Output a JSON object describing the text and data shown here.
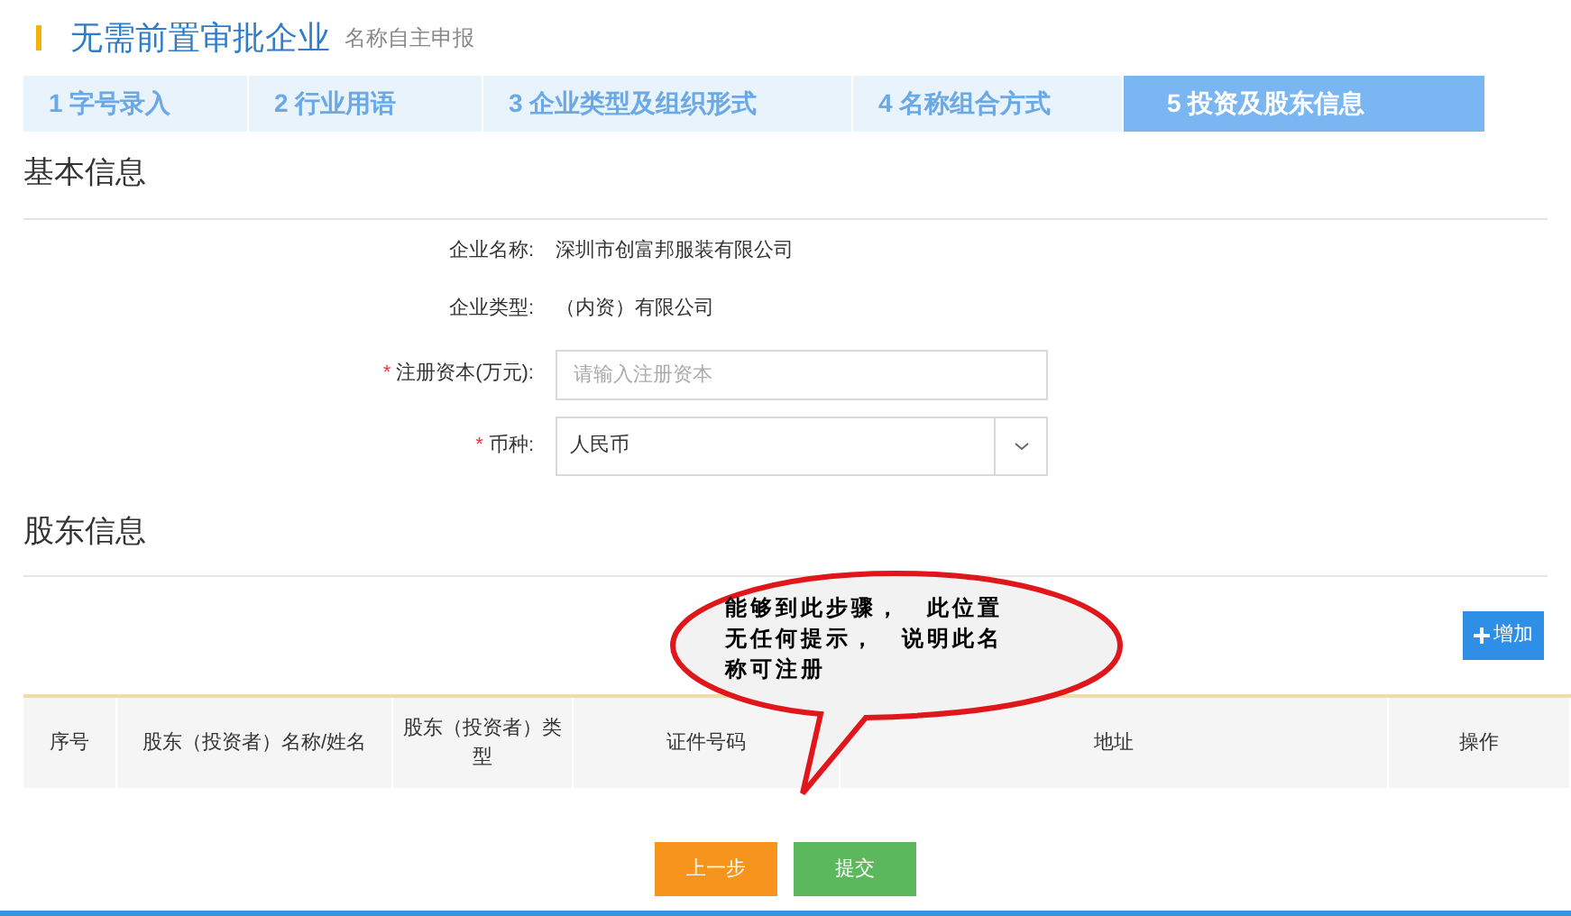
{
  "header": {
    "title": "无需前置审批企业",
    "subtitle": "名称自主申报"
  },
  "steps": [
    {
      "label": "1 字号录入",
      "selected": false
    },
    {
      "label": "2 行业用语",
      "selected": false
    },
    {
      "label": "3 企业类型及组织形式",
      "selected": false
    },
    {
      "label": "4 名称组合方式",
      "selected": false
    },
    {
      "label": "5 投资及股东信息",
      "selected": true
    }
  ],
  "basic_info": {
    "title": "基本信息",
    "fields": [
      {
        "kind": "text",
        "label": "企业名称:",
        "value": "深圳市创富邦服装有限公司"
      },
      {
        "kind": "text",
        "label": "企业类型:",
        "value": "（内资）有限公司"
      },
      {
        "kind": "input",
        "required_mark": "*",
        "label": "注册资本(万元):",
        "placeholder": "请输入注册资本"
      },
      {
        "kind": "select",
        "required_mark": "*",
        "label": "币种:",
        "value": "人民币"
      }
    ]
  },
  "shareholders": {
    "title": "股东信息",
    "add_button": "增加",
    "columns": [
      "序号",
      "股东（投资者）名称/姓名",
      "股东（投资者）类型",
      "证件号码",
      "地址",
      "操作"
    ]
  },
  "callout": {
    "text": "能够到此步骤，　此位置无任何提示，　说明此名称可注册"
  },
  "buttons": [
    {
      "kind": "back",
      "label": "上一步"
    },
    {
      "kind": "submit",
      "label": "提交"
    }
  ]
}
